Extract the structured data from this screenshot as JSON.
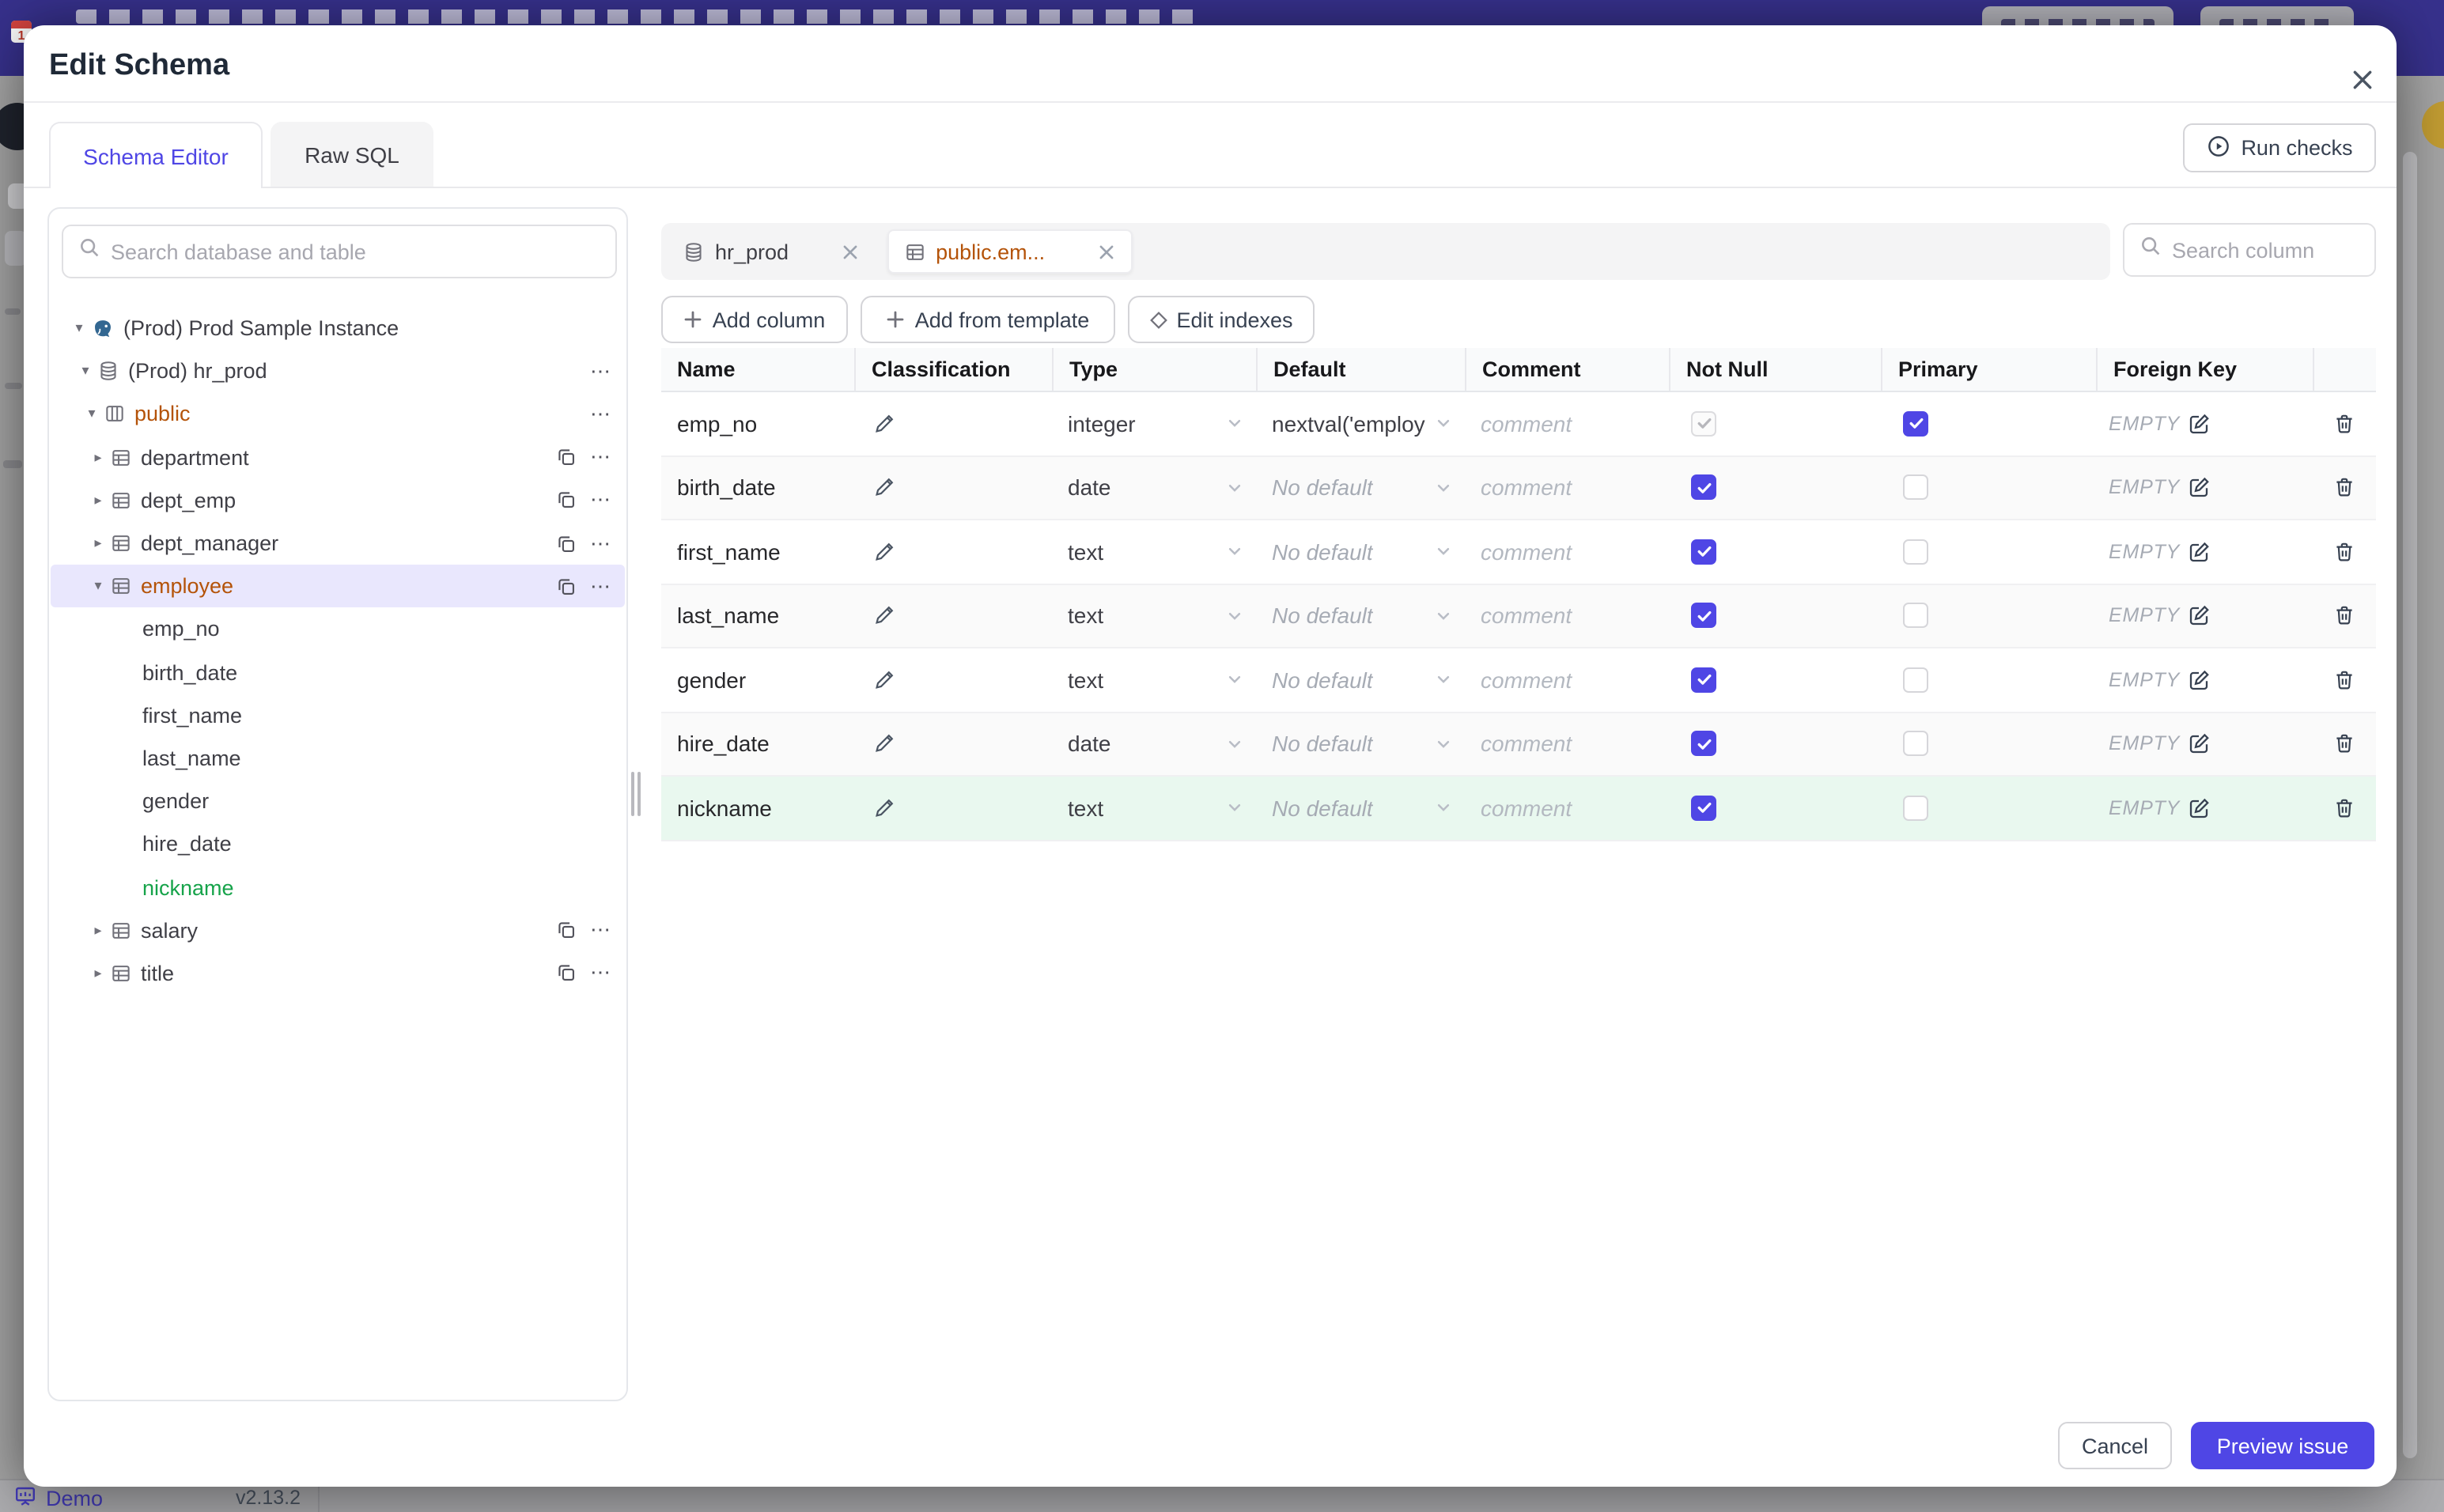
{
  "colors": {
    "accent": "#4f46e5",
    "modified_orange": "#b45309",
    "added_green": "#16a34a",
    "added_row_bg": "#e9f8ef",
    "topbar": "#37318c"
  },
  "page_status": {
    "app": "Demo",
    "version": "v2.13.2"
  },
  "modal": {
    "title": "Edit Schema",
    "tabs": [
      {
        "label": "Schema Editor",
        "active": true
      },
      {
        "label": "Raw SQL",
        "active": false
      }
    ],
    "run_checks_label": "Run checks",
    "sidebar": {
      "search_placeholder": "Search database and table",
      "tree": [
        {
          "label": "(Prod) Prod Sample Instance",
          "depth": 0,
          "icon": "instance",
          "caret": "down",
          "color": "default",
          "selected": false,
          "actions": []
        },
        {
          "label": "(Prod) hr_prod",
          "depth": 1,
          "icon": "database",
          "caret": "down",
          "color": "default",
          "selected": false,
          "actions": [
            "more"
          ]
        },
        {
          "label": "public",
          "depth": 2,
          "icon": "schema",
          "caret": "down",
          "color": "modified",
          "selected": false,
          "actions": [
            "more"
          ]
        },
        {
          "label": "department",
          "depth": 3,
          "icon": "table",
          "caret": "right",
          "color": "default",
          "selected": false,
          "actions": [
            "copy",
            "more"
          ]
        },
        {
          "label": "dept_emp",
          "depth": 3,
          "icon": "table",
          "caret": "right",
          "color": "default",
          "selected": false,
          "actions": [
            "copy",
            "more"
          ]
        },
        {
          "label": "dept_manager",
          "depth": 3,
          "icon": "table",
          "caret": "right",
          "color": "default",
          "selected": false,
          "actions": [
            "copy",
            "more"
          ]
        },
        {
          "label": "employee",
          "depth": 3,
          "icon": "table",
          "caret": "down",
          "color": "modified",
          "selected": true,
          "actions": [
            "copy",
            "more"
          ]
        },
        {
          "label": "emp_no",
          "depth": 4,
          "icon": "column",
          "caret": "none",
          "color": "default",
          "selected": false,
          "actions": []
        },
        {
          "label": "birth_date",
          "depth": 4,
          "icon": "column",
          "caret": "none",
          "color": "default",
          "selected": false,
          "actions": []
        },
        {
          "label": "first_name",
          "depth": 4,
          "icon": "column",
          "caret": "none",
          "color": "default",
          "selected": false,
          "actions": []
        },
        {
          "label": "last_name",
          "depth": 4,
          "icon": "column",
          "caret": "none",
          "color": "default",
          "selected": false,
          "actions": []
        },
        {
          "label": "gender",
          "depth": 4,
          "icon": "column",
          "caret": "none",
          "color": "default",
          "selected": false,
          "actions": []
        },
        {
          "label": "hire_date",
          "depth": 4,
          "icon": "column",
          "caret": "none",
          "color": "default",
          "selected": false,
          "actions": []
        },
        {
          "label": "nickname",
          "depth": 4,
          "icon": "column",
          "caret": "none",
          "color": "added",
          "selected": false,
          "actions": []
        },
        {
          "label": "salary",
          "depth": 3,
          "icon": "table",
          "caret": "right",
          "color": "default",
          "selected": false,
          "actions": [
            "copy",
            "more"
          ]
        },
        {
          "label": "title",
          "depth": 3,
          "icon": "table",
          "caret": "right",
          "color": "default",
          "selected": false,
          "actions": [
            "copy",
            "more"
          ]
        }
      ]
    },
    "editor": {
      "chips": [
        {
          "label": "hr_prod",
          "icon": "database",
          "active": false,
          "color": "default"
        },
        {
          "label": "public.em...",
          "icon": "table",
          "active": true,
          "color": "modified"
        }
      ],
      "column_search_placeholder": "Search column",
      "actions": [
        {
          "label": "Add column",
          "icon": "plus"
        },
        {
          "label": "Add from template",
          "icon": "plus"
        },
        {
          "label": "Edit indexes",
          "icon": "diamond"
        }
      ],
      "table": {
        "columns": [
          "Name",
          "Classification",
          "Type",
          "Default",
          "Comment",
          "Not Null",
          "Primary",
          "Foreign Key"
        ],
        "foreign_key_empty_label": "EMPTY",
        "comment_placeholder": "comment",
        "rows": [
          {
            "name": "emp_no",
            "type": "integer",
            "default": "nextval('employ",
            "default_set": true,
            "not_null_checked": true,
            "not_null_disabled": true,
            "primary_checked": true,
            "foreign_key": "EMPTY",
            "added": false
          },
          {
            "name": "birth_date",
            "type": "date",
            "default": "No default",
            "default_set": false,
            "not_null_checked": true,
            "not_null_disabled": false,
            "primary_checked": false,
            "foreign_key": "EMPTY",
            "added": false
          },
          {
            "name": "first_name",
            "type": "text",
            "default": "No default",
            "default_set": false,
            "not_null_checked": true,
            "not_null_disabled": false,
            "primary_checked": false,
            "foreign_key": "EMPTY",
            "added": false
          },
          {
            "name": "last_name",
            "type": "text",
            "default": "No default",
            "default_set": false,
            "not_null_checked": true,
            "not_null_disabled": false,
            "primary_checked": false,
            "foreign_key": "EMPTY",
            "added": false
          },
          {
            "name": "gender",
            "type": "text",
            "default": "No default",
            "default_set": false,
            "not_null_checked": true,
            "not_null_disabled": false,
            "primary_checked": false,
            "foreign_key": "EMPTY",
            "added": false
          },
          {
            "name": "hire_date",
            "type": "date",
            "default": "No default",
            "default_set": false,
            "not_null_checked": true,
            "not_null_disabled": false,
            "primary_checked": false,
            "foreign_key": "EMPTY",
            "added": false
          },
          {
            "name": "nickname",
            "type": "text",
            "default": "No default",
            "default_set": false,
            "not_null_checked": true,
            "not_null_disabled": false,
            "primary_checked": false,
            "foreign_key": "EMPTY",
            "added": true
          }
        ]
      }
    },
    "footer": {
      "cancel_label": "Cancel",
      "primary_label": "Preview issue"
    }
  }
}
